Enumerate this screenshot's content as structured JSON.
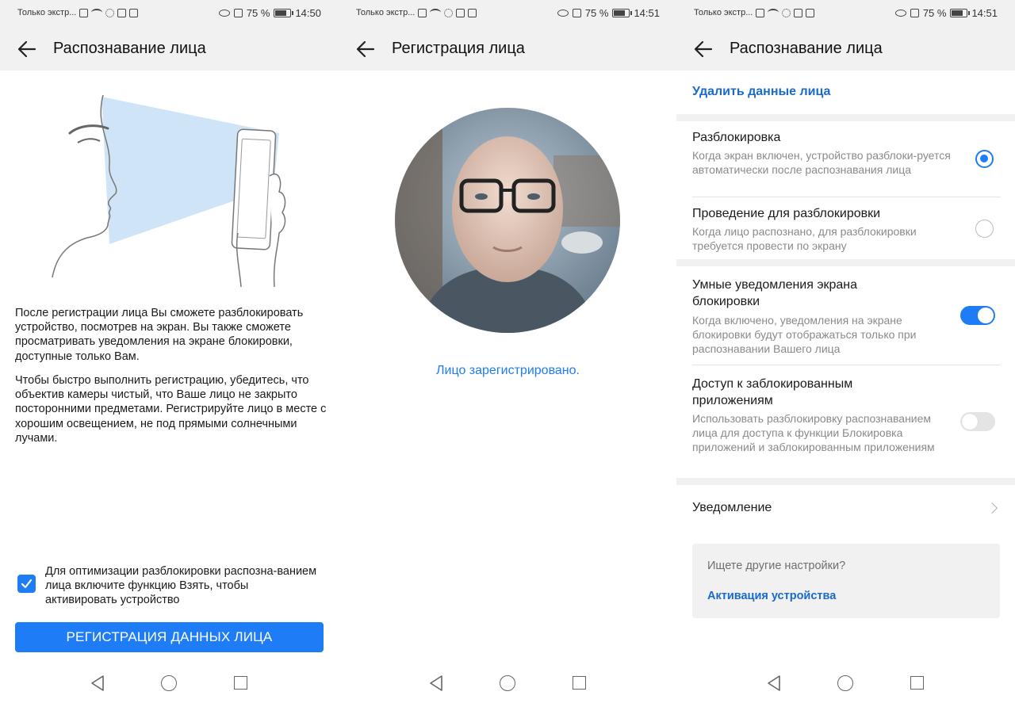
{
  "status_bars": [
    {
      "carrier": "Только экстр...",
      "battery": "75 %",
      "time": "14:50"
    },
    {
      "carrier": "Только экстр...",
      "battery": "75 %",
      "time": "14:51"
    },
    {
      "carrier": "Только экстр...",
      "battery": "75 %",
      "time": "14:51"
    }
  ],
  "screen1": {
    "title": "Распознавание лица",
    "paragraph1": "После регистрации лица Вы сможете разблокировать устройство, посмотрев на экран. Вы также сможете просматривать уведомления на экране блокировки, доступные только Вам.",
    "paragraph2": "Чтобы быстро выполнить регистрацию, убедитесь, что объектив камеры чистый, что Ваше лицо не закрыто посторонними предметами. Регистрируйте лицо в месте с хорошим освещением, не под прямыми солнечными лучами.",
    "checkbox_label": "Для оптимизации разблокировки распозна-ванием лица включите функцию Взять, чтобы активировать устройство",
    "checkbox_checked": true,
    "register_button": "РЕГИСТРАЦИЯ ДАННЫХ ЛИЦА"
  },
  "screen2": {
    "title": "Регистрация лица",
    "status": "Лицо зарегистрировано."
  },
  "screen3": {
    "title": "Распознавание лица",
    "delete_link": "Удалить данные лица",
    "unlock": {
      "title": "Разблокировка",
      "desc": "Когда экран включен, устройство разблоки-руется автоматически после распознавания лица",
      "selected": true
    },
    "swipe_unlock": {
      "title": "Проведение для разблокировки",
      "desc": "Когда лицо распознано, для разблокировки требуется провести по экрану",
      "selected": false
    },
    "smart_notifications": {
      "title": "Умные уведомления экрана блокировки",
      "desc": "Когда включено, уведомления на экране блокировки будут отображаться только при распознавании Вашего лица",
      "enabled": true
    },
    "locked_apps": {
      "title": "Доступ к заблокированным приложениям",
      "desc": "Использовать разблокировку распознаванием лица для доступа к функции Блокировка приложений и заблокированным приложениям",
      "enabled": false
    },
    "notification_row": "Уведомление",
    "suggest": {
      "question": "Ищете другие настройки?",
      "link": "Активация устройства"
    }
  },
  "colors": {
    "accent": "#1e7df6",
    "link": "#1b6ac9",
    "header_bg": "#f1f1f1",
    "secondary_text": "#8a8a8a"
  }
}
